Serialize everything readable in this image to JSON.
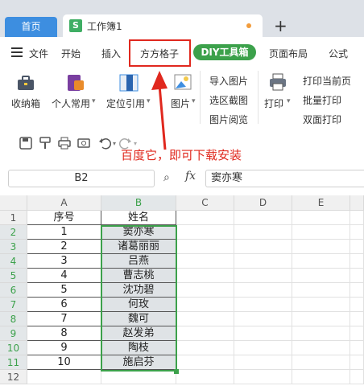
{
  "tabs": {
    "home": "首页",
    "doc_icon": "S",
    "doc_title": "工作簿1",
    "plus": "+"
  },
  "menu": {
    "file": "文件",
    "start": "开始",
    "insert": "插入",
    "ffgz": "方方格子",
    "diy": "DIY工具箱",
    "layout": "页面布局",
    "formula": "公式"
  },
  "ribbon": {
    "collect": "收纳箱",
    "personal": "个人常用",
    "locate": "定位引用",
    "picture": "图片",
    "import_pic": "导入图片",
    "region_shot": "选区截图",
    "pic_browse": "图片阅览",
    "print": "打印",
    "print_current": "打印当前页",
    "batch_print": "批量打印",
    "duplex_print": "双面打印"
  },
  "annotation": "百度它，即可下载安装",
  "formula_bar": {
    "cell_ref": "B2",
    "fx": "fx",
    "value": "窦亦寒"
  },
  "grid": {
    "columns": [
      "A",
      "B",
      "C",
      "D",
      "E"
    ],
    "rows": [
      "1",
      "2",
      "3",
      "4",
      "5",
      "6",
      "7",
      "8",
      "9",
      "10",
      "11",
      "12"
    ],
    "header": [
      "序号",
      "姓名"
    ],
    "data": [
      [
        "1",
        "窦亦寒"
      ],
      [
        "2",
        "诸葛丽丽"
      ],
      [
        "3",
        "吕燕"
      ],
      [
        "4",
        "曹志桃"
      ],
      [
        "5",
        "沈功碧"
      ],
      [
        "6",
        "何玫"
      ],
      [
        "7",
        "魏可"
      ],
      [
        "8",
        "赵发弟"
      ],
      [
        "9",
        "陶枝"
      ],
      [
        "10",
        "施启芬"
      ]
    ]
  },
  "colors": {
    "accent_green": "#3ca14b",
    "tab_blue": "#3d8ee0",
    "annotation_red": "#e0281e"
  }
}
